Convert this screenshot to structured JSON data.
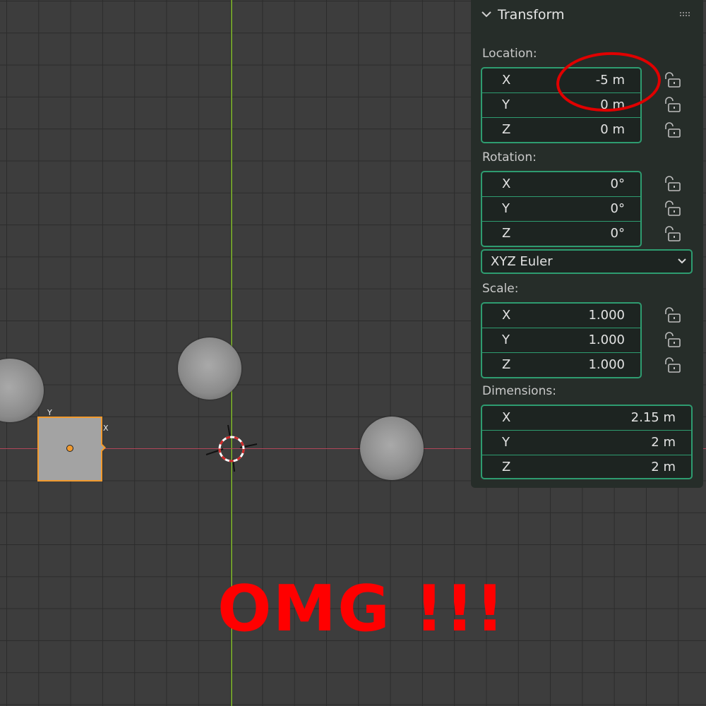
{
  "panel": {
    "title": "Transform",
    "location": {
      "label": "Location:",
      "rows": [
        {
          "axis": "X",
          "value": "-5 m"
        },
        {
          "axis": "Y",
          "value": "0 m"
        },
        {
          "axis": "Z",
          "value": "0 m"
        }
      ]
    },
    "rotation": {
      "label": "Rotation:",
      "rows": [
        {
          "axis": "X",
          "value": "0°"
        },
        {
          "axis": "Y",
          "value": "0°"
        },
        {
          "axis": "Z",
          "value": "0°"
        }
      ],
      "mode": "XYZ Euler"
    },
    "scale": {
      "label": "Scale:",
      "rows": [
        {
          "axis": "X",
          "value": "1.000"
        },
        {
          "axis": "Y",
          "value": "1.000"
        },
        {
          "axis": "Z",
          "value": "1.000"
        }
      ]
    },
    "dimensions": {
      "label": "Dimensions:",
      "rows": [
        {
          "axis": "X",
          "value": "2.15 m"
        },
        {
          "axis": "Y",
          "value": "2 m"
        },
        {
          "axis": "Z",
          "value": "2 m"
        }
      ]
    }
  },
  "viewport": {
    "gizmo": {
      "x_label": "X",
      "y_label": "Y"
    },
    "annotation_text": "OMG !!!"
  },
  "colors": {
    "viewport_bg": "#3d3d3d",
    "grid": "#2c2c2c",
    "y_axis": "#6f9a2c",
    "x_axis": "#b3475a",
    "selection": "#f29a2e",
    "field_border": "#2e9c70",
    "annotation": "#ff0000"
  }
}
